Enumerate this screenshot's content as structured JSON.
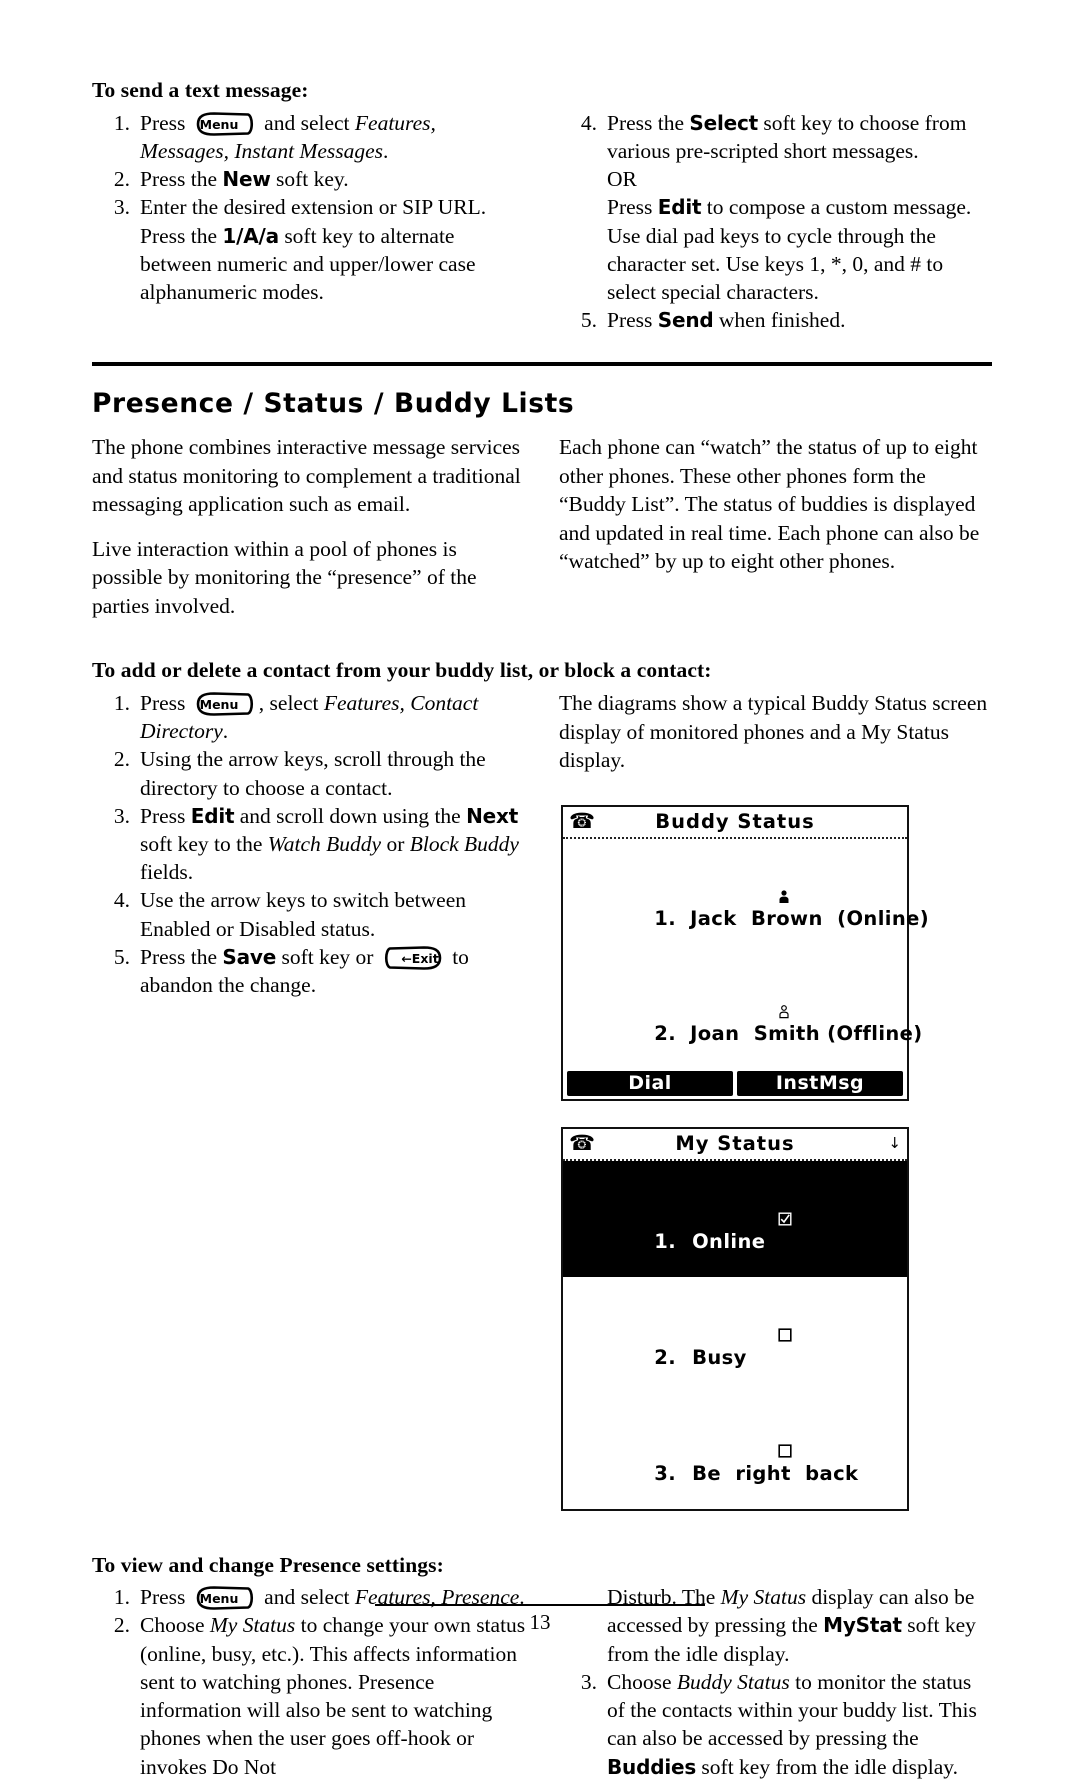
{
  "page_number": "13",
  "section_text_message": {
    "heading": "To send a text message:",
    "left_steps": [
      {
        "num": "1.",
        "pre": "Press ",
        "key": "Menu",
        "post_plain": " and select ",
        "post_italic": "Features, Messages, Instant Messages",
        "tail": "."
      },
      {
        "num": "2.",
        "pre": "Press the ",
        "softkey": "New",
        "post_plain": " soft key."
      },
      {
        "num": "3.",
        "pre": "Enter the desired extension or SIP URL.  Press the ",
        "softkey": "1/A/a",
        "post_plain": " soft key to alternate between numeric and upper/lower case alphanumeric modes."
      }
    ],
    "right_steps": [
      {
        "num": "4.",
        "pre": "Press the ",
        "softkey": "Select",
        "post_plain": " soft key to choose from various pre-scripted short messages."
      },
      {
        "or_label": "OR"
      },
      {
        "pre": "Press ",
        "softkey": "Edit",
        "post_plain": " to compose a custom message.  Use dial pad keys to cycle through the character set.  Use keys 1, *, 0, and # to select special characters."
      },
      {
        "num": "5.",
        "pre": "Press ",
        "softkey": "Send",
        "post_plain": " when finished."
      }
    ]
  },
  "section_presence": {
    "heading": "Presence / Status / Buddy Lists",
    "left_paragraphs": [
      "The phone combines interactive message services and status monitoring to complement a traditional messaging application such as email.",
      "Live interaction within a pool of phones is possible by monitoring the “presence” of the parties involved."
    ],
    "right_paragraphs": [
      "Each phone can “watch” the status of up to eight other phones.  These other phones form the “Buddy List”.  The status of buddies is displayed and updated in real time.  Each phone can also be “watched” by up to eight other phones."
    ]
  },
  "section_buddy_contact": {
    "heading": "To add or delete a contact from your buddy list, or block a contact:",
    "steps": [
      {
        "num": "1.",
        "pre": "Press ",
        "key": "Menu",
        "post_plain": ", select ",
        "post_italic": "Features, Contact Directory",
        "tail": "."
      },
      {
        "num": "2.",
        "pre": "Using the arrow keys, scroll through the directory to choose a contact."
      },
      {
        "num": "3.",
        "pre": "Press ",
        "softkey": "Edit",
        "mid_plain": " and scroll down using the ",
        "softkey2": "Next",
        "post_plain": " soft key to the ",
        "post_italic": "Watch Buddy",
        "mid2": " or ",
        "post_italic2": "Block Buddy",
        "tail": " fields."
      },
      {
        "num": "4.",
        "pre": "Use the arrow keys to switch between Enabled or Disabled status."
      },
      {
        "num": "5.",
        "pre": "Press the ",
        "softkey": "Save",
        "mid_plain": " soft key or ",
        "key": "Exit",
        "post_plain": " to abandon the change."
      }
    ],
    "right_intro": "The diagrams show a typical Buddy Status screen display of monitored phones and a My Status display."
  },
  "lcd_buddy_status": {
    "phone_icon": "telephone-icon",
    "title": "Buddy  Status",
    "rows": [
      {
        "index": "1.",
        "icon": "person-filled-icon",
        "text": "Jack  Brown  (Online)"
      },
      {
        "index": "2.",
        "icon": "person-outline-icon",
        "text": "Joan  Smith (Offline)"
      }
    ],
    "softkeys": [
      "Dial",
      "InstMsg"
    ]
  },
  "lcd_my_status": {
    "phone_icon": "telephone-icon",
    "title": "My  Status",
    "scroll_arrow": "↓",
    "rows": [
      {
        "index": "1.",
        "icon": "checkbox-checked-icon",
        "text": "Online",
        "selected": true
      },
      {
        "index": "2.",
        "icon": "checkbox-empty-icon",
        "text": "Busy",
        "selected": false
      },
      {
        "index": "3.",
        "icon": "checkbox-empty-icon",
        "text": "Be  right  back",
        "selected": false
      }
    ]
  },
  "section_presence_settings": {
    "heading": "To view and change Presence settings:",
    "left_steps": [
      {
        "num": "1.",
        "pre": "Press ",
        "key": "Menu",
        "post_plain": " and select ",
        "post_italic": "Features, Presence",
        "tail": "."
      },
      {
        "num": "2.",
        "pre": "Choose ",
        "post_italic": "My Status",
        "post_plain": " to change your own status (online, busy, etc.).  This affects information sent to watching phones.  Presence information will also be sent to watching phones when the user goes off-hook or invokes Do Not"
      }
    ],
    "right_steps": [
      {
        "cont": "Disturb.  The ",
        "post_italic": "My Status",
        "mid_plain": " display can also be accessed by pressing the ",
        "softkey": "MyStat",
        "post_plain": " soft key from the idle display."
      },
      {
        "num": "3.",
        "pre": "Choose ",
        "post_italic": "Buddy Status",
        "mid_plain": " to monitor the status of the contacts within your buddy list.  This can also be accessed by pressing the ",
        "softkey": "Buddies",
        "post_plain": " soft key from the idle display."
      }
    ]
  }
}
